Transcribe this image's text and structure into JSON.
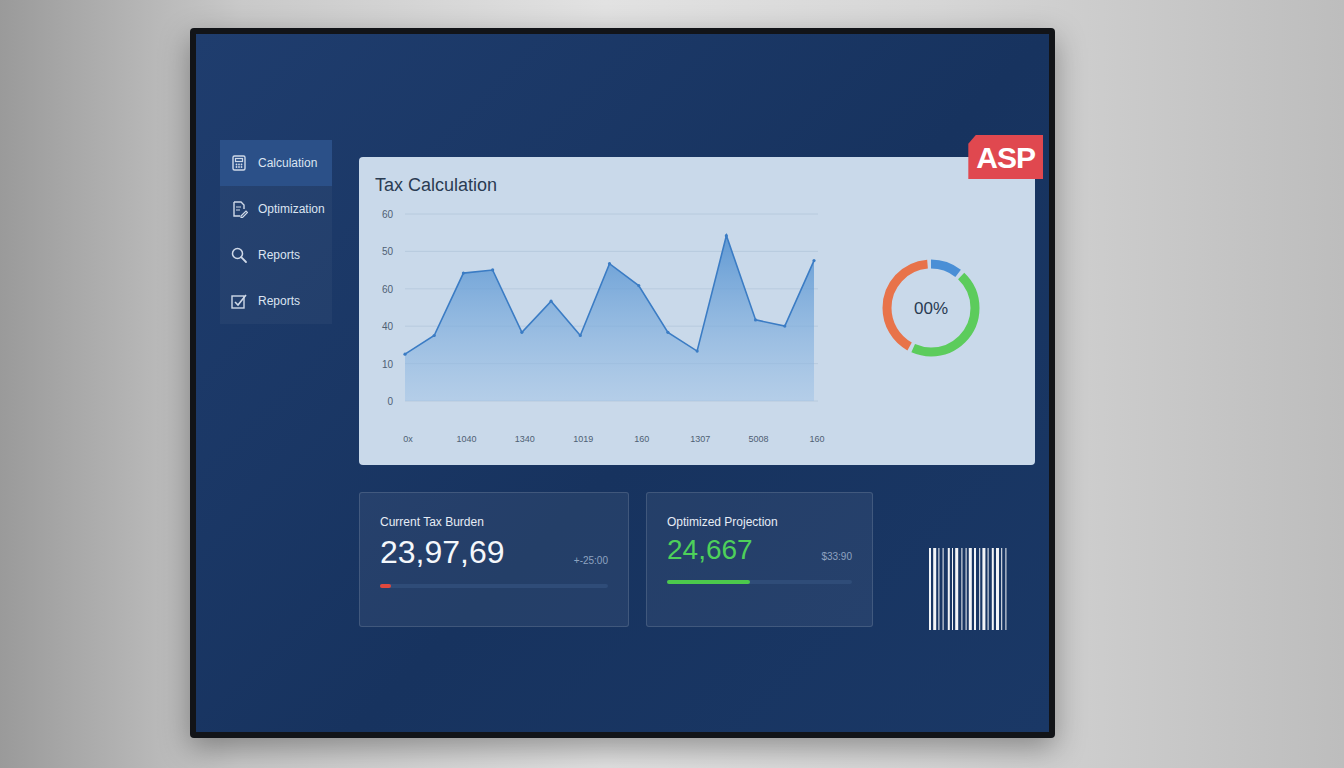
{
  "logo": "ASP",
  "sidebar": {
    "items": [
      {
        "label": "Calculation",
        "selected": true
      },
      {
        "label": "Optimization",
        "selected": false
      },
      {
        "label": "Reports",
        "selected": false
      },
      {
        "label": "Reports",
        "selected": false
      }
    ]
  },
  "chart": {
    "title": "Tax Calculation",
    "y_ticks": [
      "60",
      "50",
      "60",
      "40",
      "10",
      "0"
    ],
    "x_ticks": [
      "0x",
      "1040",
      "1340",
      "1019",
      "160",
      "1307",
      "5008",
      "160"
    ],
    "series": [
      {
        "values": [
          15,
          21,
          41,
          42,
          22,
          32,
          21,
          44,
          37,
          22,
          16,
          53,
          26,
          24,
          45
        ]
      }
    ]
  },
  "donut": {
    "label": "00%",
    "segments": [
      {
        "level": 0.12,
        "color": "#4a8fd6"
      },
      {
        "level": 0.46,
        "color": "#5ccc5c"
      },
      {
        "level": 0.42,
        "color": "#e8734a"
      }
    ]
  },
  "cards": [
    {
      "kind": "current",
      "title": "Current Tax Burden",
      "value": "23,97,69",
      "reading": "+-25:00",
      "level": 0.05,
      "color": "#e0483e"
    },
    {
      "kind": "optimized",
      "title": "Optimized Projection",
      "value": "24,667",
      "reading": "$33:90",
      "level": 0.45,
      "color": "#4cc94c"
    }
  ]
}
